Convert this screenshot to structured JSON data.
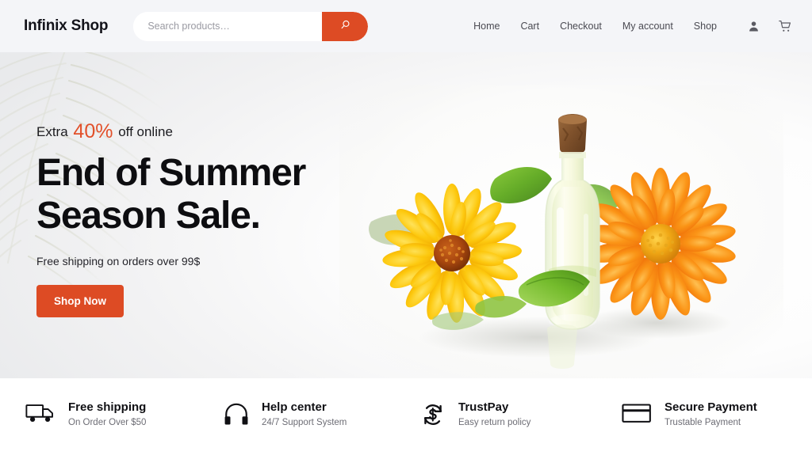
{
  "theme": {
    "accent": "#dd4b24",
    "accent_text": "#e2502a",
    "header_bg": "#f4f5f8",
    "hero_bg": "#e8e9eb",
    "text_dark": "#0d0d10",
    "text_muted": "#6d6d75"
  },
  "header": {
    "logo": "Infinix Shop",
    "search": {
      "placeholder": "Search products…",
      "value": "",
      "button_icon": "search-icon"
    },
    "nav": [
      {
        "label": "Home"
      },
      {
        "label": "Cart"
      },
      {
        "label": "Checkout"
      },
      {
        "label": "My account"
      },
      {
        "label": "Shop"
      }
    ],
    "icons": [
      {
        "name": "account-icon"
      },
      {
        "name": "cart-icon"
      }
    ]
  },
  "hero": {
    "eyebrow_before": "Extra",
    "eyebrow_percent": "40%",
    "eyebrow_after": "off online",
    "title_line1": "End of Summer",
    "title_line2": "Season Sale.",
    "subtitle": "Free shipping on orders over 99$",
    "cta_label": "Shop Now",
    "background_art": "palm-frond-watermark",
    "product_image": "essential-oil-bottle-with-calendula-flowers"
  },
  "features": [
    {
      "icon": "truck-icon",
      "title": "Free shipping",
      "desc": "On Order Over $50"
    },
    {
      "icon": "headphones-icon",
      "title": "Help center",
      "desc": "24/7 Support System"
    },
    {
      "icon": "refresh-dollar-icon",
      "title": "TrustPay",
      "desc": "Easy return policy"
    },
    {
      "icon": "credit-card-icon",
      "title": "Secure Payment",
      "desc": "Trustable Payment"
    }
  ]
}
